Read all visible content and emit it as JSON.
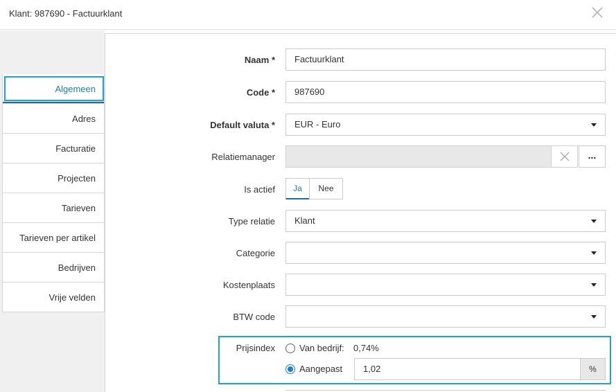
{
  "window": {
    "title": "Klant: 987690 - Factuurklant"
  },
  "tabs": [
    {
      "label": "Algemeen"
    },
    {
      "label": "Adres"
    },
    {
      "label": "Facturatie"
    },
    {
      "label": "Projecten"
    },
    {
      "label": "Tarieven"
    },
    {
      "label": "Tarieven per artikel"
    },
    {
      "label": "Bedrijven"
    },
    {
      "label": "Vrije velden"
    }
  ],
  "form": {
    "naam": {
      "label": "Naam *",
      "value": "Factuurklant"
    },
    "code": {
      "label": "Code *",
      "value": "987690"
    },
    "valuta": {
      "label": "Default valuta *",
      "value": "EUR - Euro"
    },
    "relatiemanager": {
      "label": "Relatiemanager",
      "value": "",
      "more": "..."
    },
    "actief": {
      "label": "Is actief",
      "ja": "Ja",
      "nee": "Nee",
      "selected": "Ja"
    },
    "type_relatie": {
      "label": "Type relatie",
      "value": "Klant"
    },
    "categorie": {
      "label": "Categorie",
      "value": ""
    },
    "kostenplaats": {
      "label": "Kostenplaats",
      "value": ""
    },
    "btw_code": {
      "label": "BTW code",
      "value": ""
    },
    "prijsindex": {
      "label": "Prijsindex",
      "van_bedrijf_label": "Van bedrijf:",
      "van_bedrijf_value": "0,74%",
      "aangepast_label": "Aangepast",
      "aangepast_value": "1,02",
      "suffix": "%",
      "selected": "Aangepast"
    }
  },
  "colors": {
    "accent": "#1aa3d9",
    "active_text": "#1a7fb0",
    "radio": "#1a7fd1"
  },
  "icons": {
    "close": "close-icon",
    "clear": "clear-x-icon",
    "caret": "caret-down-icon"
  }
}
